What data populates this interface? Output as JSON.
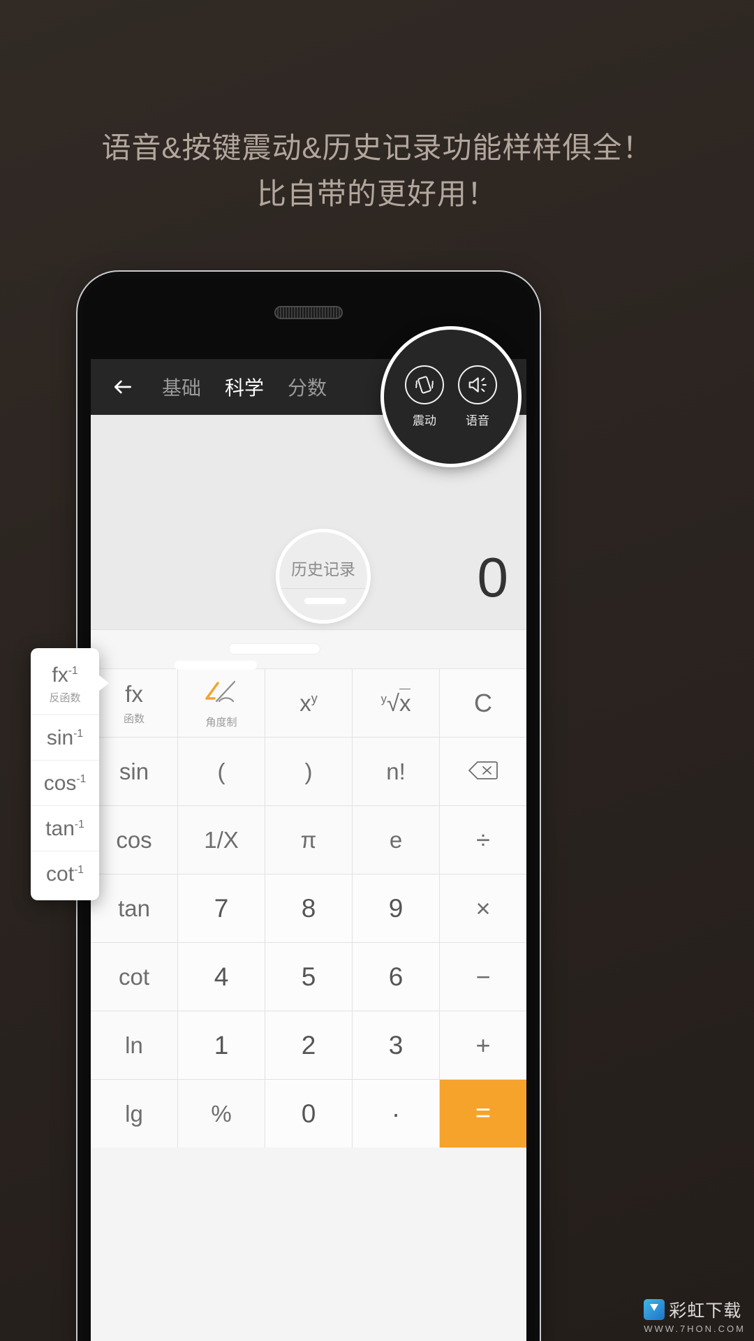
{
  "promo": {
    "headline_line1": "语音&按键震动&历史记录功能样样俱全！",
    "headline_line2": "比自带的更好用！"
  },
  "app": {
    "toolbar": {
      "back_icon": "back-arrow-icon",
      "tabs": [
        {
          "label": "基础",
          "active": false
        },
        {
          "label": "科学",
          "active": true
        },
        {
          "label": "分数",
          "active": false
        }
      ]
    },
    "display": {
      "value": "0",
      "secondary": ""
    },
    "keypad": [
      {
        "label": "fx",
        "sub": "函数",
        "type": "func"
      },
      {
        "label": "",
        "sub": "角度制",
        "type": "angle",
        "icon": "angle-mode-icon",
        "accent": "#f5a32a"
      },
      {
        "label": "x^y",
        "sub": "",
        "type": "func"
      },
      {
        "label": "y√x",
        "sub": "",
        "type": "func"
      },
      {
        "label": "C",
        "sub": "",
        "type": "op"
      },
      {
        "label": "sin",
        "sub": "",
        "type": "func"
      },
      {
        "label": "(",
        "sub": "",
        "type": "func"
      },
      {
        "label": ")",
        "sub": "",
        "type": "func"
      },
      {
        "label": "n!",
        "sub": "",
        "type": "func"
      },
      {
        "label": "",
        "sub": "",
        "type": "op",
        "icon": "backspace-icon"
      },
      {
        "label": "cos",
        "sub": "",
        "type": "func"
      },
      {
        "label": "1/X",
        "sub": "",
        "type": "func"
      },
      {
        "label": "π",
        "sub": "",
        "type": "func"
      },
      {
        "label": "e",
        "sub": "",
        "type": "func"
      },
      {
        "label": "÷",
        "sub": "",
        "type": "op"
      },
      {
        "label": "tan",
        "sub": "",
        "type": "func"
      },
      {
        "label": "7",
        "sub": "",
        "type": "digit"
      },
      {
        "label": "8",
        "sub": "",
        "type": "digit"
      },
      {
        "label": "9",
        "sub": "",
        "type": "digit"
      },
      {
        "label": "×",
        "sub": "",
        "type": "op"
      },
      {
        "label": "cot",
        "sub": "",
        "type": "func"
      },
      {
        "label": "4",
        "sub": "",
        "type": "digit"
      },
      {
        "label": "5",
        "sub": "",
        "type": "digit"
      },
      {
        "label": "6",
        "sub": "",
        "type": "digit"
      },
      {
        "label": "−",
        "sub": "",
        "type": "op"
      },
      {
        "label": "ln",
        "sub": "",
        "type": "func"
      },
      {
        "label": "1",
        "sub": "",
        "type": "digit"
      },
      {
        "label": "2",
        "sub": "",
        "type": "digit"
      },
      {
        "label": "3",
        "sub": "",
        "type": "digit"
      },
      {
        "label": "+",
        "sub": "",
        "type": "op"
      },
      {
        "label": "lg",
        "sub": "",
        "type": "func"
      },
      {
        "label": "%",
        "sub": "",
        "type": "func"
      },
      {
        "label": "0",
        "sub": "",
        "type": "digit"
      },
      {
        "label": "·",
        "sub": "",
        "type": "digit"
      },
      {
        "label": "=",
        "sub": "",
        "type": "equals"
      }
    ]
  },
  "magnifier_settings": {
    "items": [
      {
        "icon": "vibrate-icon",
        "label": "震动"
      },
      {
        "icon": "speaker-icon",
        "label": "语音"
      }
    ]
  },
  "magnifier_history": {
    "label": "历史记录"
  },
  "inverse_popup": {
    "items": [
      {
        "label": "fx",
        "exp": "-1",
        "sub": "反函数"
      },
      {
        "label": "sin",
        "exp": "-1",
        "sub": ""
      },
      {
        "label": "cos",
        "exp": "-1",
        "sub": ""
      },
      {
        "label": "tan",
        "exp": "-1",
        "sub": ""
      },
      {
        "label": "cot",
        "exp": "-1",
        "sub": ""
      }
    ]
  },
  "watermark": {
    "name": "彩虹下载",
    "url": "WWW.7HON.COM"
  },
  "colors": {
    "background": "#2b2420",
    "headline": "#b3a79d",
    "toolbar": "#262626",
    "accent_orange": "#f5a32a",
    "key_text": "#6d6d6d"
  }
}
